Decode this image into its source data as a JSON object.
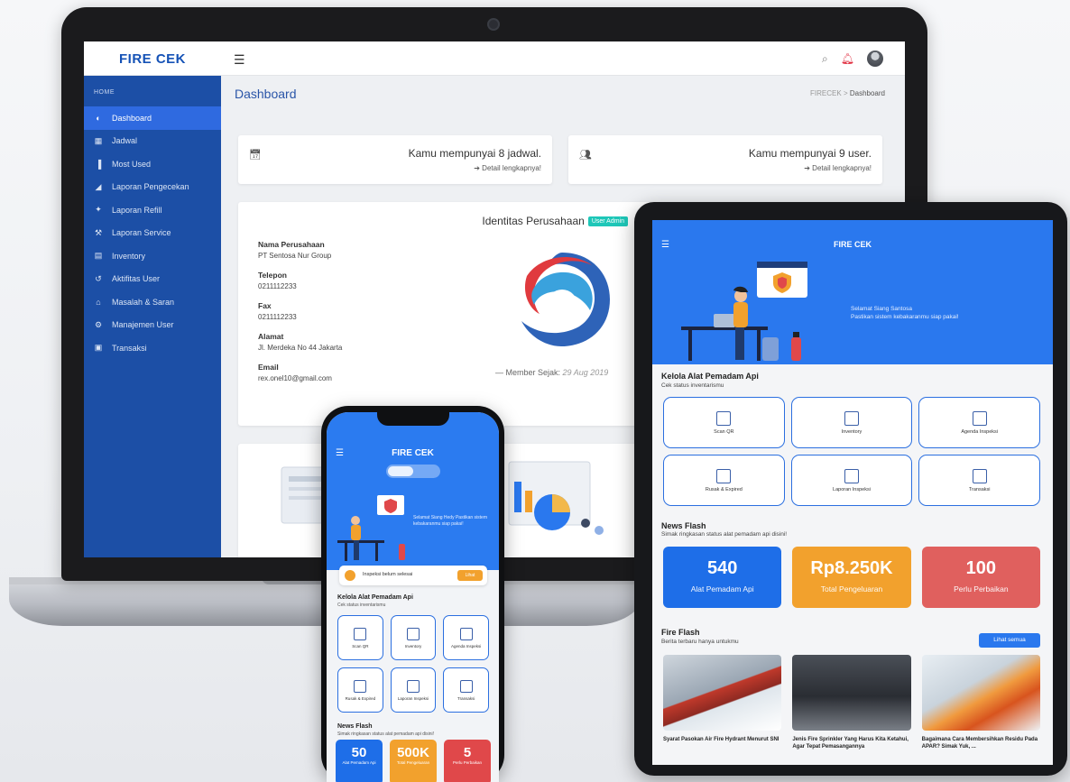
{
  "laptop": {
    "brand": "FIRE CEK",
    "breadcrumb": {
      "root": "FIRECEK",
      "sep": ">",
      "current": "Dashboard"
    },
    "page_title": "Dashboard",
    "sidebar": {
      "section": "HOME",
      "items": [
        {
          "label": "Dashboard",
          "icon": "dashboard-icon",
          "active": true
        },
        {
          "label": "Jadwal",
          "icon": "calendar-icon"
        },
        {
          "label": "Most Used",
          "icon": "bar-chart-icon"
        },
        {
          "label": "Laporan Pengecekan",
          "icon": "report-chart-icon"
        },
        {
          "label": "Laporan Refill",
          "icon": "refill-icon"
        },
        {
          "label": "Laporan Service",
          "icon": "wrench-icon"
        },
        {
          "label": "Inventory",
          "icon": "inventory-icon"
        },
        {
          "label": "Aktifitas User",
          "icon": "history-icon"
        },
        {
          "label": "Masalah & Saran",
          "icon": "inbox-icon"
        },
        {
          "label": "Manajemen User",
          "icon": "user-gear-icon"
        },
        {
          "label": "Transaksi",
          "icon": "transaction-icon"
        }
      ]
    },
    "cards": {
      "schedule": {
        "text": "Kamu mempunyai 8 jadwal.",
        "link": "Detail lengkapnya!"
      },
      "users": {
        "text": "Kamu mempunyai 9 user.",
        "link": "Detail lengkapnya!"
      }
    },
    "company": {
      "title": "Identitas Perusahaan",
      "badge": "User Admin",
      "fields": [
        {
          "label": "Nama Perusahaan",
          "value": "PT Sentosa Nur Group"
        },
        {
          "label": "Telepon",
          "value": "0211112233"
        },
        {
          "label": "Fax",
          "value": "0211112233"
        },
        {
          "label": "Alamat",
          "value": "Jl. Merdeka No 44 Jakarta"
        },
        {
          "label": "Email",
          "value": "rex.onel10@gmail.com"
        }
      ],
      "member_label": "— Member Sejak:",
      "member_date": "29 Aug 2019"
    }
  },
  "phone": {
    "brand": "FIRE CEK",
    "greeting": "Selamat Siang Hedy Pastikan sistem kebakaranmu siap pakai!",
    "alert": {
      "text": "Inspeksi belum selesai",
      "button": "Lihat"
    },
    "section_title": "Kelola Alat Pemadam Api",
    "section_sub": "Cek status inventarismu",
    "tiles": [
      "Scan QR",
      "Inventory",
      "Agenda Inspeksi",
      "Rusak & Expired",
      "Laporan Inspeksi",
      "Transaksi"
    ],
    "news_title": "News Flash",
    "news_sub": "Simak ringkasan status alat pemadam api disini!",
    "stats": [
      {
        "value": "50",
        "label": "Alat Pemadam Api",
        "color": "#1e6ee8"
      },
      {
        "value": "500K",
        "label": "Total Pengeluaran",
        "color": "#f2a12d"
      },
      {
        "value": "5",
        "label": "Perlu Perbaikan",
        "color": "#e0484a"
      }
    ]
  },
  "tablet": {
    "brand": "FIRE CEK",
    "greeting_line1": "Selamat Siang Santosa",
    "greeting_line2": "Pastikan sistem kebakaranmu siap pakai!",
    "section_title": "Kelola Alat Pemadam Api",
    "section_sub": "Cek status inventarismu",
    "tiles": [
      "Scan QR",
      "Inventory",
      "Agenda Inspeksi",
      "Rusak & Expired",
      "Laporan Inspeksi",
      "Transaksi"
    ],
    "news_title": "News Flash",
    "news_sub": "Simak ringkasan status alat pemadam api disini!",
    "stats": [
      {
        "value": "540",
        "label": "Alat Pemadam Api",
        "color": "#1e6ee8"
      },
      {
        "value": "Rp8.250K",
        "label": "Total Pengeluaran",
        "color": "#f2a12d"
      },
      {
        "value": "100",
        "label": "Perlu Perbaikan",
        "color": "#e0605e"
      }
    ],
    "fire_title": "Fire Flash",
    "fire_sub": "Berita terbaru hanya untukmu",
    "fire_more": "Lihat semua",
    "articles": [
      "Syarat Pasokan Air Fire Hydrant Menurut SNI",
      "Jenis Fire Sprinkler Yang Harus Kita Ketahui, Agar Tepat Pemasangannya",
      "Bagaimana Cara Membersihkan Residu Pada APAR? Simak Yuk, ..."
    ]
  }
}
